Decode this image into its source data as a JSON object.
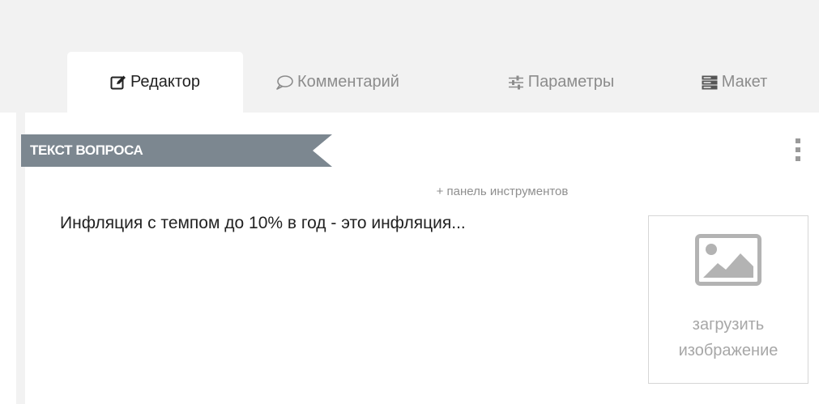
{
  "tabs": [
    {
      "label": "Редактор",
      "icon": "edit-icon",
      "active": true
    },
    {
      "label": "Комментарий",
      "icon": "comment-icon",
      "active": false
    },
    {
      "label": "Параметры",
      "icon": "sliders-icon",
      "active": false
    },
    {
      "label": "Макет",
      "icon": "layout-icon",
      "active": false
    }
  ],
  "question": {
    "section_label": "ТЕКСТ ВОПРОСА",
    "toolbar_toggle": "+ панель инструментов",
    "text": "Инфляция с темпом до 10% в год - это инфляция..."
  },
  "image_upload": {
    "line1": "загрузить",
    "line2": "изображение",
    "icon": "image-icon"
  },
  "colors": {
    "ribbon": "#7c8790",
    "tab_bar_bg": "#f2f2f2",
    "active_tab_bg": "#ffffff",
    "text_primary": "#222222",
    "text_muted": "#8c8c8c",
    "icon_gray": "#b3b3b3"
  }
}
